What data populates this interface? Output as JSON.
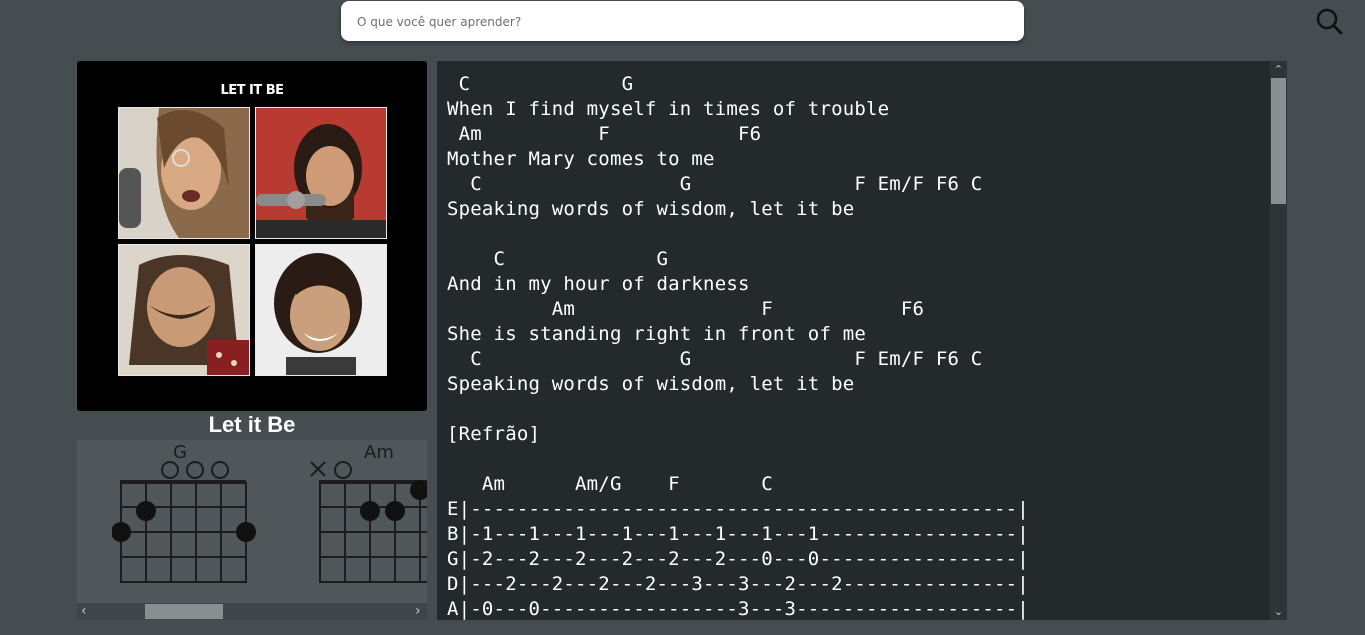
{
  "search": {
    "placeholder": "O que você quer aprender?"
  },
  "album": {
    "cover_text": "LET IT BE"
  },
  "song": {
    "title": "Let it Be"
  },
  "chord_diagrams": [
    {
      "name": "G"
    },
    {
      "name": "Am"
    }
  ],
  "lyrics": " C             G\nWhen I find myself in times of trouble\n Am          F           F6\nMother Mary comes to me\n  C                 G              F Em/F F6 C\nSpeaking words of wisdom, let it be\n\n    C             G\nAnd in my hour of darkness\n         Am                F           F6\nShe is standing right in front of me\n  C                 G              F Em/F F6 C\nSpeaking words of wisdom, let it be\n\n[Refrão]\n\n   Am      Am/G    F       C\nE|-----------------------------------------------|\nB|-1---1---1---1---1---1---1---1-----------------|\nG|-2---2---2---2---2---2---0---0-----------------|\nD|---2---2---2---2---3---3---2---2---------------|\nA|-0---0-----------------3---3-------------------|",
  "icons": {
    "search": "search-icon",
    "scroll_left": "chevron-left-icon",
    "scroll_right": "chevron-right-icon",
    "scroll_up": "chevron-up-icon",
    "scroll_down": "chevron-down-icon"
  },
  "colors": {
    "page_bg": "#454d51",
    "lyrics_bg": "#242a2c",
    "chord_panel_bg": "#4f575b"
  }
}
